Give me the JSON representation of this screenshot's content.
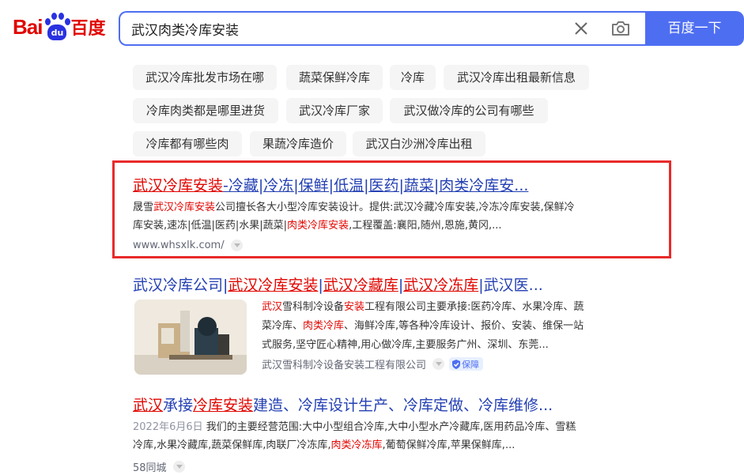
{
  "logo": {
    "bai": "Bai",
    "du": "du",
    "cn": "百度"
  },
  "search": {
    "query": "武汉肉类冷库安装",
    "button": "百度一下"
  },
  "related": [
    "武汉冷库批发市场在哪",
    "蔬菜保鲜冷库",
    "冷库",
    "武汉冷库出租最新信息",
    "冷库肉类都是哪里进货",
    "武汉冷库厂家",
    "武汉做冷库的公司有哪些",
    "冷库都有哪些肉",
    "果蔬冷库造价",
    "武汉白沙洲冷库出租"
  ],
  "results": [
    {
      "title_hl": "武汉冷库安装",
      "title_rest": "-冷藏|冷冻|保鲜|低温|医药|蔬菜|肉类冷库安...",
      "abs1_a": "晟雪",
      "abs1_hl": "武汉冷库安装",
      "abs1_b": "公司擅长各大小型冷库安装设计。提供:武汉冷藏冷库安装,冷冻冷库安装,保鲜冷",
      "abs2_a": "库安装,速冻|低温|医药|水果|蔬菜|",
      "abs2_hl": "肉类冷库安装",
      "abs2_b": ",工程覆盖:襄阳,随州,恩施,黄冈,...",
      "url": "www.whsxlk.com/"
    },
    {
      "title_a": "武汉冷库公司|",
      "title_hl1": "武汉冷库安装",
      "title_sep1": "|",
      "title_hl2": "武汉冷藏库",
      "title_sep2": "|",
      "title_hl3": "武汉冷冻库",
      "title_b": "|武汉医...",
      "abs1_hl": "武汉",
      "abs1_a": "雪科制冷设备",
      "abs1_hl2": "安装",
      "abs1_b": "工程有限公司主要承接:医药冷库、水果冷库、蔬",
      "abs2_a": "菜冷库、",
      "abs2_hl": "肉类冷库",
      "abs2_b": "、海鲜冷库,等各种冷库设计、报价、安装、维保一站",
      "abs3": "式服务,坚守匠心精神,用心做冷库,主要服务广州、深圳、东莞...",
      "source": "武汉雪科制冷设备安装工程有限公司",
      "badge": "保障"
    },
    {
      "title_hl1": "武汉",
      "title_a": "承接",
      "title_hl2": "冷库安装",
      "title_b": "建造、冷库设计生产、冷库定做、冷库维修...",
      "date": "2022年6月6日",
      "abs1": " 我们的主要经营范围:大中小型组合冷库,大中小型水产冷藏库,医用药品冷库、雪糕",
      "abs2_a": "冷库,水果冷藏库,蔬菜保鲜库,肉联厂冷冻库,",
      "abs2_hl": "肉类冷冻库",
      "abs2_b": ",葡萄保鲜冷库,苹果保鲜库,...",
      "source": "58同城"
    }
  ],
  "colors": {
    "accent": "#4e6ef2",
    "highlight": "#e10601",
    "link": "#2440b3",
    "frame": "#e92a2a"
  }
}
